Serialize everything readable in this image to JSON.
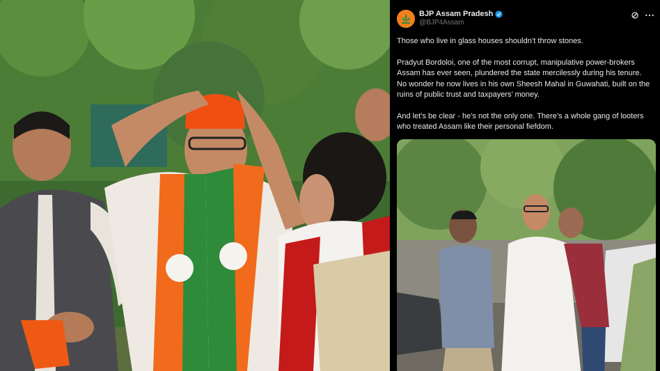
{
  "account": {
    "name": "BJP Assam Pradesh",
    "handle": "@BJP4Assam"
  },
  "tweet": {
    "paragraphs": [
      "Those who live in glass houses shouldn’t throw stones.",
      "Pradyut Bordoloi, one of the most corrupt, manipulative power-brokers Assam has ever seen, plundered the state mercilessly during his tenure. No wonder he now lives in his own Sheesh Mahal in Guwahati, built on the ruins of public trust and taxpayers’ money.",
      "And let’s be clear - he’s not the only one. There’s a whole gang of looters who treated Assam like their personal fiefdom."
    ]
  },
  "colors": {
    "saffron": "#f26a1b",
    "green": "#2e8b3a",
    "verified": "#1d9bf0",
    "panel_bg": "#000000"
  },
  "icons": [
    "verified-badge-icon",
    "grok-icon",
    "more-options-icon"
  ]
}
